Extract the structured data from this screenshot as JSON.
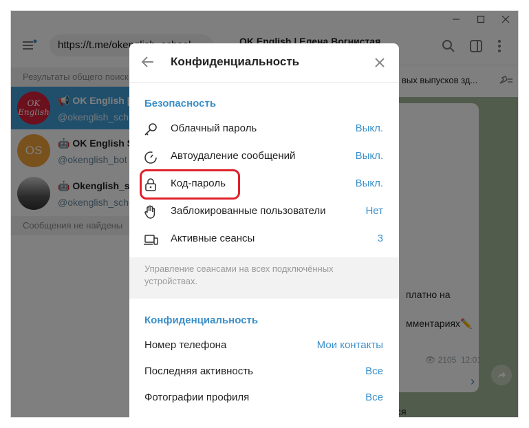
{
  "browser": {
    "url": "https://t.me/okenglish_school",
    "channel_title": "OK English | Елена Вогнистая"
  },
  "search": {
    "results_header": "Результаты общего поиска",
    "messages_not_found": "Сообщения не найдены"
  },
  "results": [
    {
      "title": "OK English | Е",
      "handle": "@okenglish_school",
      "avatar_text": "OK English",
      "avatar_color": "#d8203a"
    },
    {
      "title": "OK English Sch",
      "handle": "@okenglish_bot",
      "avatar_text": "OS",
      "avatar_color": "#f2a23a"
    },
    {
      "title": "Okenglish_sch",
      "handle": "@okenglish_scho",
      "avatar_text": "",
      "avatar_color": "#555555"
    }
  ],
  "chat": {
    "pinned_text": "вых выпусков зд...",
    "lines": [
      "платно на",
      "мментариях✏️"
    ],
    "views": "2105",
    "time": "12:01",
    "bottom_fragment": "ся"
  },
  "modal": {
    "title": "Конфиденциальность",
    "security_title": "Безопасность",
    "security_rows": [
      {
        "label": "Облачный пароль",
        "value": "Выкл.",
        "icon": "key-icon"
      },
      {
        "label": "Автоудаление сообщений",
        "value": "Выкл.",
        "icon": "timer-icon"
      },
      {
        "label": "Код-пароль",
        "value": "Выкл.",
        "icon": "lock-icon"
      },
      {
        "label": "Заблокированные пользователи",
        "value": "Нет",
        "icon": "hand-icon"
      },
      {
        "label": "Активные сеансы",
        "value": "3",
        "icon": "devices-icon"
      }
    ],
    "sessions_note": "Управление сеансами на всех подключённых устройствах.",
    "privacy_title": "Конфиденциальность",
    "privacy_rows": [
      {
        "label": "Номер телефона",
        "value": "Мои контакты"
      },
      {
        "label": "Последняя активность",
        "value": "Все"
      },
      {
        "label": "Фотографии профиля",
        "value": "Все"
      }
    ]
  },
  "colors": {
    "accent": "#3a8fc9",
    "active_row": "#419fd9",
    "highlight": "#e0202a"
  }
}
